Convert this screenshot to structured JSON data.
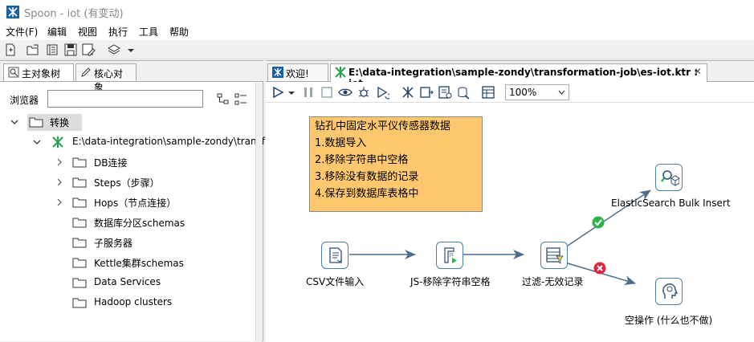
{
  "window": {
    "title": "Spoon - iot (有变动)"
  },
  "menu": [
    "文件(F)",
    "编辑",
    "视图",
    "执行",
    "工具",
    "帮助"
  ],
  "left_tabs": {
    "main_tree": "主对象树",
    "core_objects": "核心对象"
  },
  "browser": {
    "label": "浏览器",
    "value": ""
  },
  "tree": {
    "root": "转换",
    "transform": "E:\\data-integration\\sample-zondy\\transf",
    "children": [
      "DB连接",
      "Steps（步骤）",
      "Hops（节点连接）",
      "数据库分区schemas",
      "子服务器",
      "Kettle集群schemas",
      "Data Services",
      "Hadoop clusters"
    ]
  },
  "editor_tabs": {
    "welcome": "欢迎!",
    "transform": "E:\\data-integration\\sample-zondy\\transformation-job\\es-iot.ktr : iot"
  },
  "zoom": {
    "value": "100%"
  },
  "note": {
    "lines": [
      "钻孔中固定水平仪传感器数据",
      "1.数据导入",
      "2.移除字符串中空格",
      "3.移除没有数据的记录",
      "4.保存到数据库表格中"
    ]
  },
  "steps": {
    "csv": "CSV文件输入",
    "js": "JS-移除字符串空格",
    "filter": "过滤-无效记录",
    "es": "ElasticSearch Bulk Insert",
    "dummy": "空操作 (什么也不做)"
  },
  "colors": {
    "note": "#ffc86e",
    "ok": "#2db34a",
    "err": "#e0243a",
    "hop": "#4d6d8a",
    "step_border": "#4a7fa8"
  }
}
